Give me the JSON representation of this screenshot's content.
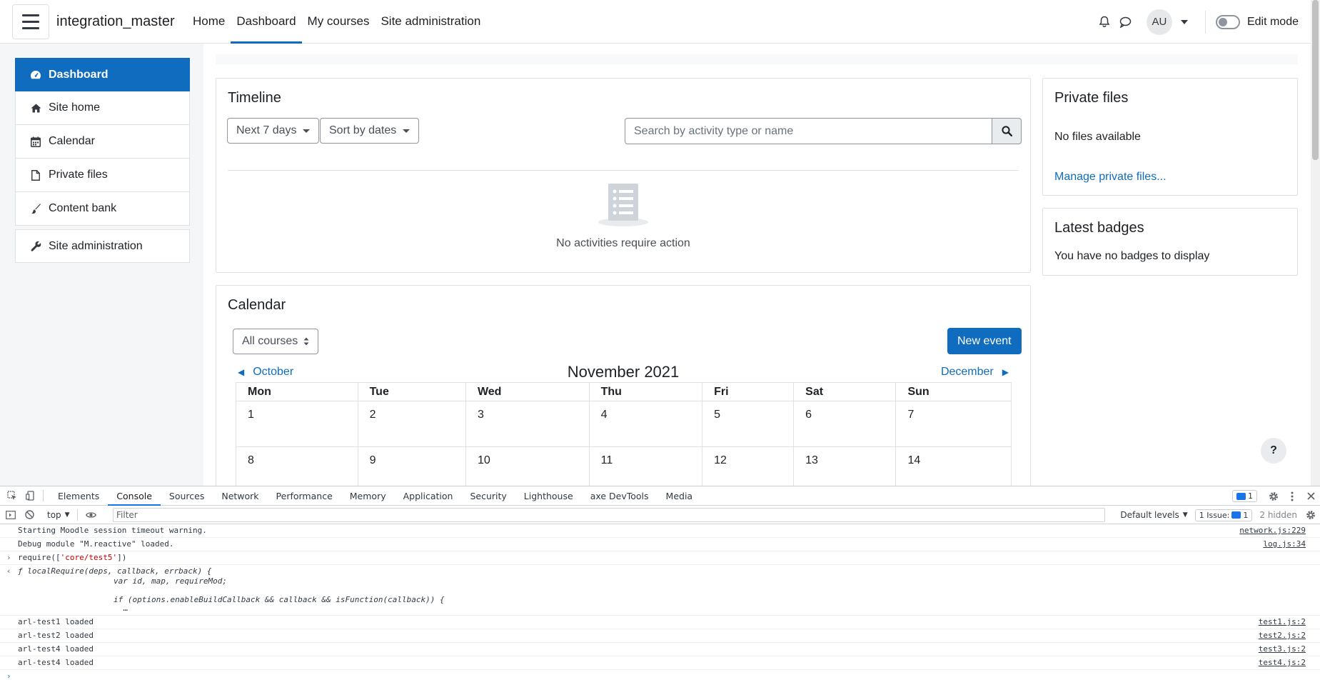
{
  "navbar": {
    "site_name": "integration_master",
    "links": [
      {
        "label": "Home"
      },
      {
        "label": "Dashboard"
      },
      {
        "label": "My courses"
      },
      {
        "label": "Site administration"
      }
    ],
    "avatar_initials": "AU",
    "edit_mode_label": "Edit mode"
  },
  "drawer": {
    "items": [
      {
        "label": "Dashboard",
        "icon": "dashboard-icon"
      },
      {
        "label": "Site home",
        "icon": "home-icon"
      },
      {
        "label": "Calendar",
        "icon": "calendar-icon"
      },
      {
        "label": "Private files",
        "icon": "file-icon"
      },
      {
        "label": "Content bank",
        "icon": "paint-brush-icon"
      }
    ],
    "admin_item": {
      "label": "Site administration",
      "icon": "wrench-icon"
    }
  },
  "timeline": {
    "title": "Timeline",
    "filter_label": "Next 7 days",
    "sort_label": "Sort by dates",
    "search_placeholder": "Search by activity type or name",
    "empty_message": "No activities require action"
  },
  "calendar": {
    "title": "Calendar",
    "course_filter": "All courses",
    "new_event_label": "New event",
    "prev_month": "October",
    "current_month": "November 2021",
    "next_month": "December",
    "weekdays": [
      "Mon",
      "Tue",
      "Wed",
      "Thu",
      "Fri",
      "Sat",
      "Sun"
    ],
    "weeks": [
      [
        "1",
        "2",
        "3",
        "4",
        "5",
        "6",
        "7"
      ],
      [
        "8",
        "9",
        "10",
        "11",
        "12",
        "13",
        "14"
      ]
    ]
  },
  "private_files": {
    "title": "Private files",
    "empty_message": "No files available",
    "manage_link": "Manage private files..."
  },
  "latest_badges": {
    "title": "Latest badges",
    "empty_message": "You have no badges to display"
  },
  "help_label": "?",
  "devtools": {
    "tabs": [
      "Elements",
      "Console",
      "Sources",
      "Network",
      "Performance",
      "Memory",
      "Application",
      "Security",
      "Lighthouse",
      "axe DevTools",
      "Media"
    ],
    "active_tab": "Console",
    "message_count": "1",
    "context": "top",
    "filter_placeholder": "Filter",
    "levels_label": "Default levels",
    "issues_label": "1 Issue:",
    "issues_count": "1",
    "hidden_label": "2 hidden",
    "console_rows": [
      {
        "text": "Starting Moodle session timeout warning.",
        "source": "network.js:229"
      },
      {
        "text": "Debug module \"M.reactive\" loaded.",
        "source": "log.js:34"
      }
    ],
    "command": {
      "prefix": "require([",
      "string": "'core/test5'",
      "suffix": "])"
    },
    "result": {
      "line1": "ƒ localRequire(deps, callback, errback) {",
      "line2": "var id, map, requireMod;",
      "line3": "if (options.enableBuildCallback && callback && isFunction(callback)) {",
      "line4": "…"
    },
    "log_rows": [
      {
        "text": "arl-test1 loaded",
        "source": "test1.js:2"
      },
      {
        "text": "arl-test2 loaded",
        "source": "test2.js:2"
      },
      {
        "text": "arl-test4 loaded",
        "source": "test3.js:2"
      },
      {
        "text": "arl-test4 loaded",
        "source": "test4.js:2"
      }
    ]
  }
}
